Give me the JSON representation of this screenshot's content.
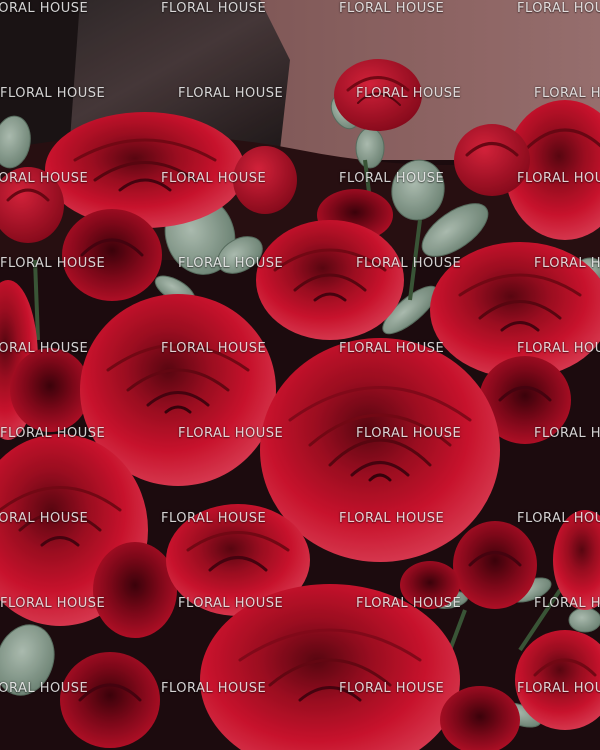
{
  "image": {
    "subject": "Bouquet of red roses with eucalyptus leaves",
    "colors": {
      "rose_red": "#c8102e",
      "rose_deep": "#7a0a18",
      "rose_light": "#e8324a",
      "eucalyptus": "#8fa596",
      "wall": "#7d5454",
      "wrap": "#3a2a2a"
    }
  },
  "watermark": {
    "text": "FLORAL HOUSE"
  }
}
